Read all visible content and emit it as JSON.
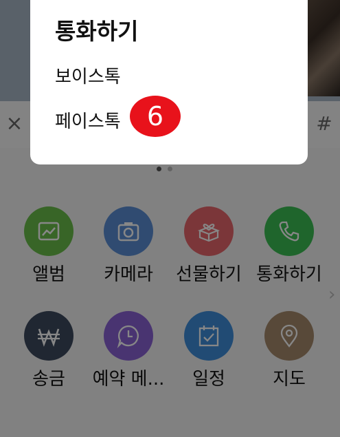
{
  "chat_input": {
    "close_symbol": "×",
    "hash_symbol": "#"
  },
  "attach_menu": {
    "items": [
      {
        "label": "앨범",
        "icon": "image-icon",
        "color": "#6abf4b"
      },
      {
        "label": "카메라",
        "icon": "camera-icon",
        "color": "#5b8fd6"
      },
      {
        "label": "선물하기",
        "icon": "gift-icon",
        "color": "#e8666c"
      },
      {
        "label": "통화하기",
        "icon": "phone-icon",
        "color": "#3cbf54"
      },
      {
        "label": "송금",
        "icon": "won-icon",
        "color": "#3d4a5f"
      },
      {
        "label": "예약 메...",
        "icon": "clock-icon",
        "color": "#8b63d6"
      },
      {
        "label": "일정",
        "icon": "calendar-icon",
        "color": "#3f8edc"
      },
      {
        "label": "지도",
        "icon": "location-pin-icon",
        "color": "#a68a6c"
      }
    ],
    "page_count": 2,
    "current_page": 1
  },
  "call_popup": {
    "title": "통화하기",
    "options": [
      "보이스톡",
      "페이스톡"
    ]
  },
  "step_badge": {
    "number": "6",
    "color": "#e8121b"
  }
}
